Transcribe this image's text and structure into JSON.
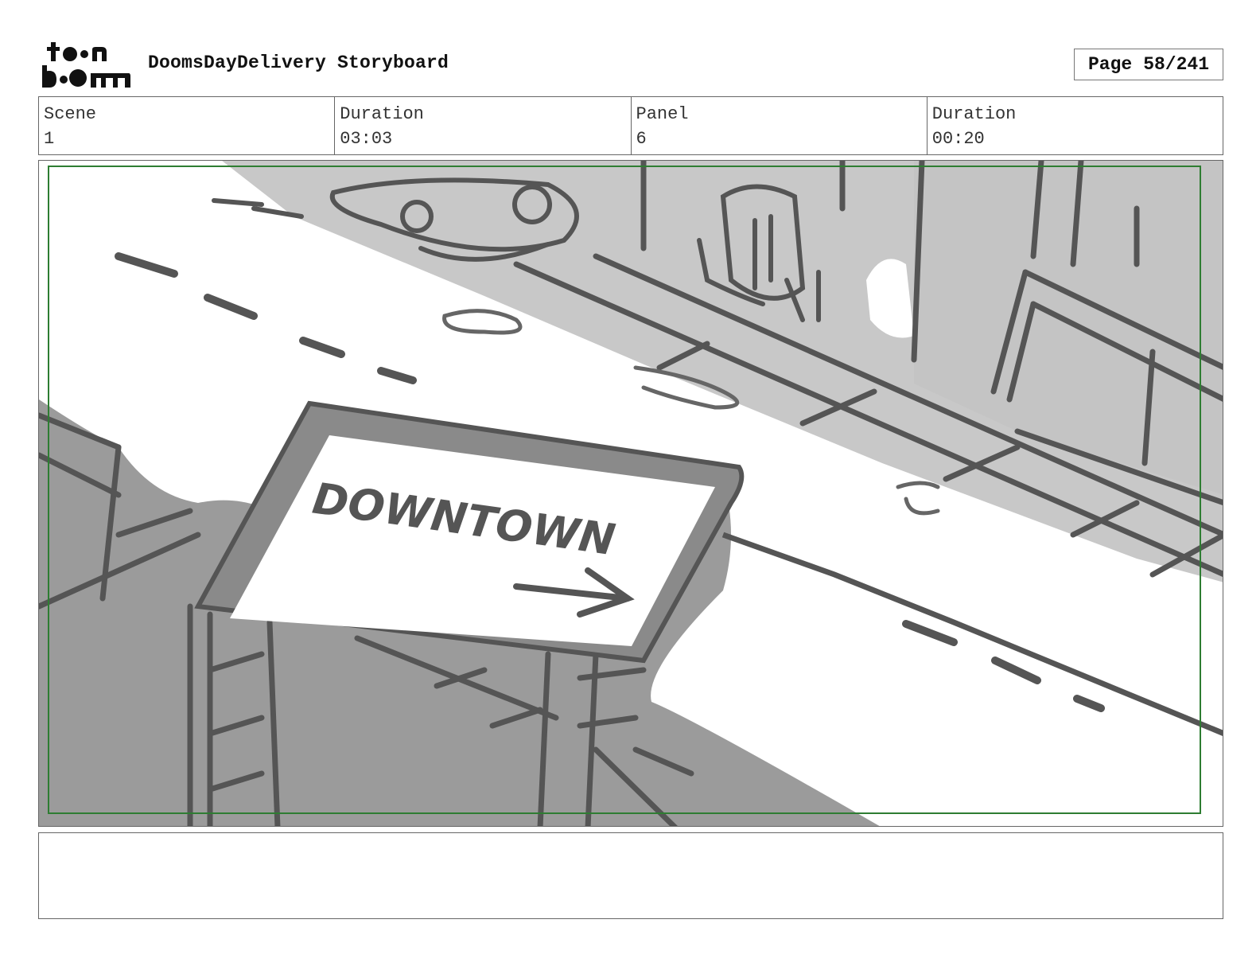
{
  "header": {
    "logo_line1": "toon",
    "logo_line2": "boom",
    "title": "DoomsDayDelivery Storyboard",
    "page_label": "Page",
    "page_value": "58/241"
  },
  "info": {
    "scene_label": "Scene",
    "scene_value": "1",
    "scene_duration_label": "Duration",
    "scene_duration_value": "03:03",
    "panel_label": "Panel",
    "panel_value": "6",
    "panel_duration_label": "Duration",
    "panel_duration_value": "00:20"
  },
  "panel": {
    "sign_text": "DOWNTOWN",
    "safe_frame_color": "#2e7d32",
    "rooftop_color": "#9a9a9a",
    "sidewalk_color": "#c8c8c8",
    "line_color": "#555555"
  },
  "notes": {
    "text": ""
  }
}
